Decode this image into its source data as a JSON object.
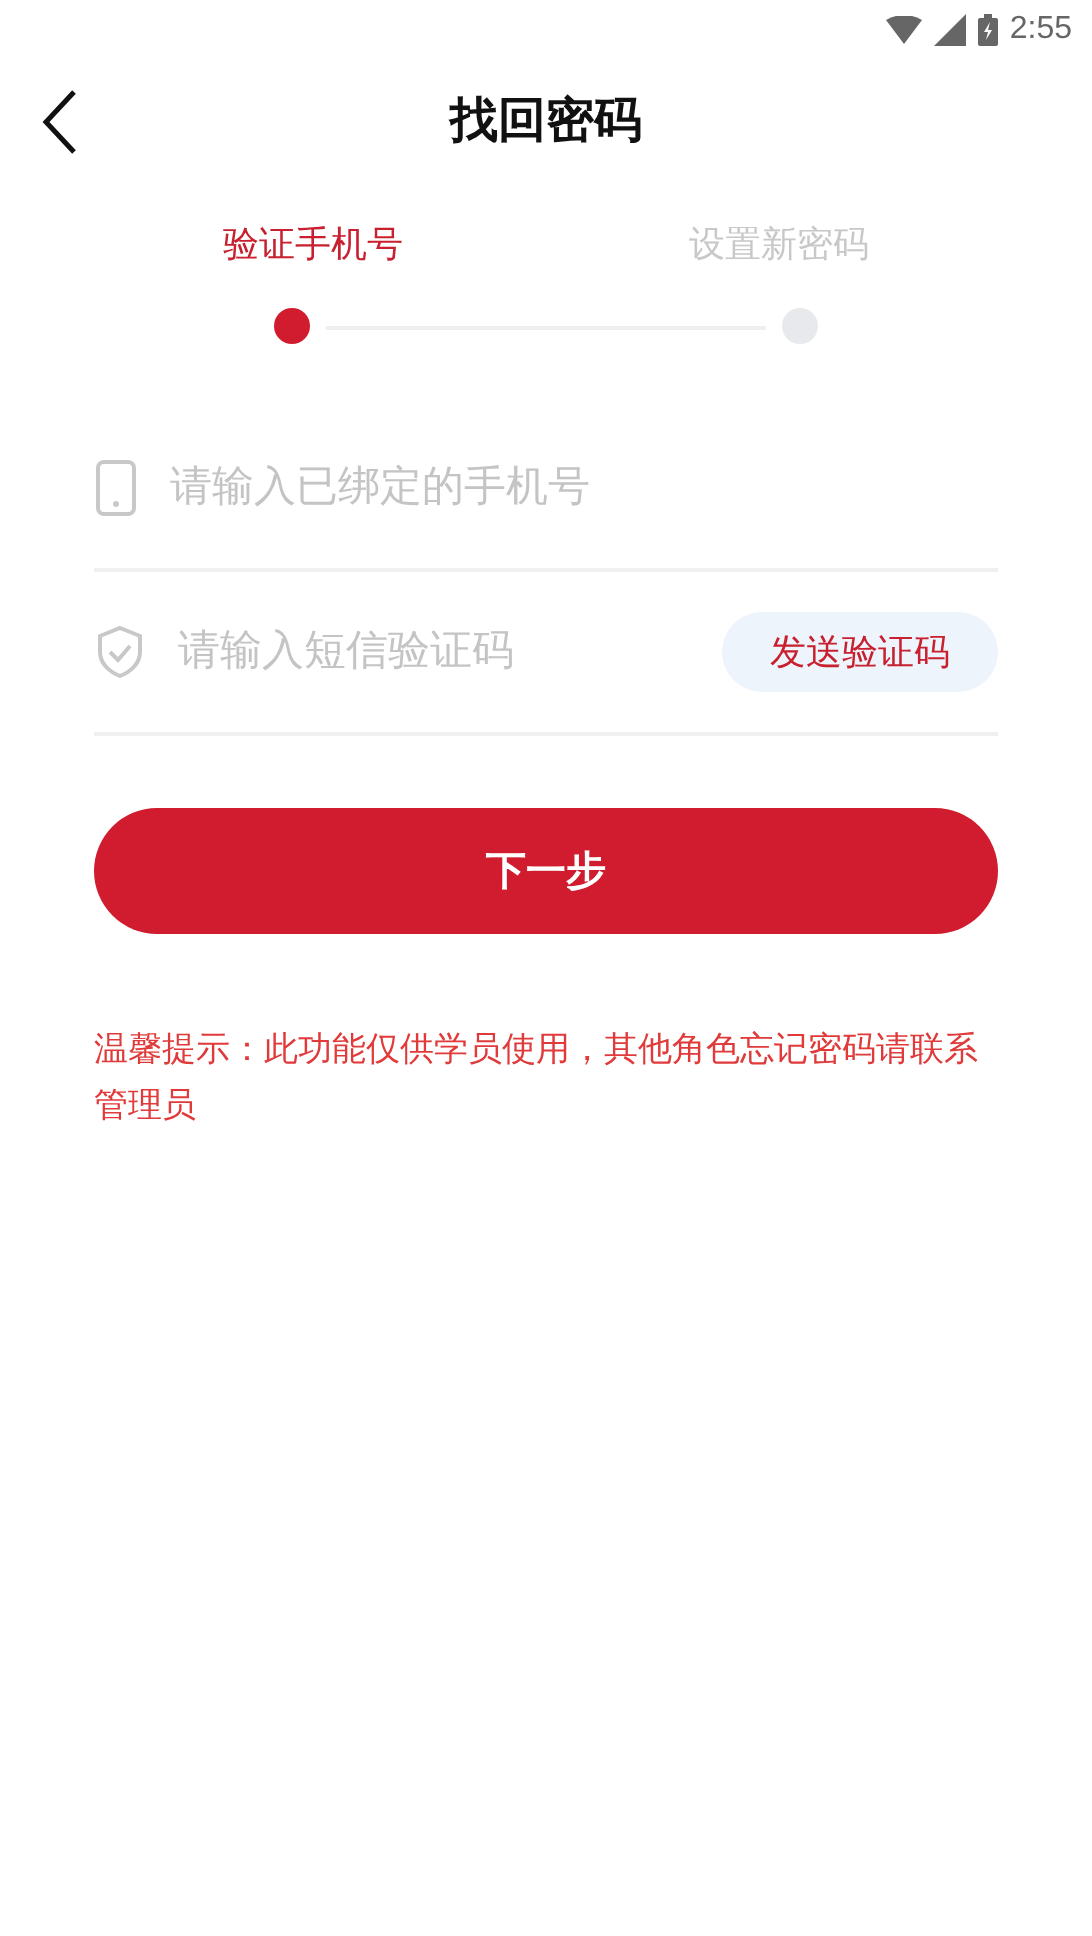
{
  "status_bar": {
    "time": "2:55"
  },
  "header": {
    "title": "找回密码"
  },
  "steps": [
    {
      "label": "验证手机号",
      "selected": true
    },
    {
      "label": "设置新密码",
      "selected": false
    }
  ],
  "fields": [
    {
      "kind": "phone",
      "placeholder": "请输入已绑定的手机号"
    },
    {
      "kind": "code",
      "placeholder": "请输入短信验证码",
      "action": "发送验证码"
    }
  ],
  "next_button": "下一步",
  "tip": "温馨提示：此功能仅供学员使用，其他角色忘记密码请联系管理员"
}
